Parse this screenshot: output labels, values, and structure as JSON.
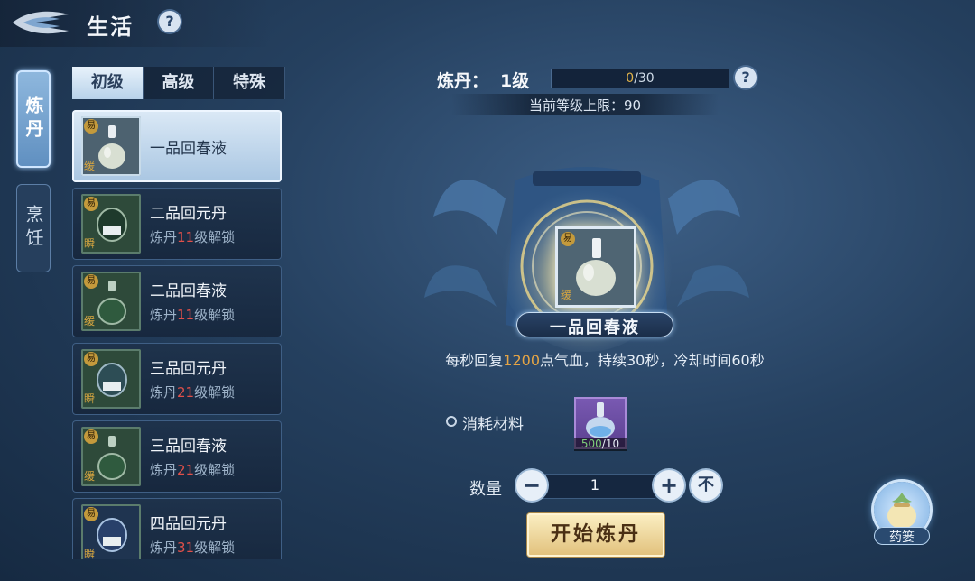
{
  "header": {
    "title": "生活",
    "help": "?"
  },
  "categories": [
    {
      "label": "炼丹",
      "active": true
    },
    {
      "label": "烹饪",
      "active": false
    }
  ],
  "grade_tabs": [
    {
      "label": "初级",
      "active": true
    },
    {
      "label": "高级",
      "active": false
    },
    {
      "label": "特殊",
      "active": false
    }
  ],
  "recipes": [
    {
      "name": "一品回春液",
      "top_badge": "易",
      "bottom_badge": "缓",
      "selected": true,
      "unlock_prefix": "",
      "unlock_level": "",
      "unlock_suffix": ""
    },
    {
      "name": "二品回元丹",
      "top_badge": "易",
      "bottom_badge": "瞬",
      "selected": false,
      "unlock_prefix": "炼丹",
      "unlock_level": "11",
      "unlock_suffix": "级解锁"
    },
    {
      "name": "二品回春液",
      "top_badge": "易",
      "bottom_badge": "缓",
      "selected": false,
      "unlock_prefix": "炼丹",
      "unlock_level": "11",
      "unlock_suffix": "级解锁"
    },
    {
      "name": "三品回元丹",
      "top_badge": "易",
      "bottom_badge": "瞬",
      "selected": false,
      "unlock_prefix": "炼丹",
      "unlock_level": "21",
      "unlock_suffix": "级解锁"
    },
    {
      "name": "三品回春液",
      "top_badge": "易",
      "bottom_badge": "缓",
      "selected": false,
      "unlock_prefix": "炼丹",
      "unlock_level": "21",
      "unlock_suffix": "级解锁"
    },
    {
      "name": "四品回元丹",
      "top_badge": "易",
      "bottom_badge": "瞬",
      "selected": false,
      "unlock_prefix": "炼丹",
      "unlock_level": "31",
      "unlock_suffix": "级解锁"
    }
  ],
  "skill": {
    "label": "炼丹：",
    "level": "1级",
    "exp_current": "0",
    "exp_total": "/30",
    "progress": 0,
    "help": "?",
    "cap_text": "当前等级上限：90"
  },
  "product": {
    "name": "一品回春液",
    "top_badge": "易",
    "bottom_badge": "缓",
    "effect_prefix": "每秒回复",
    "effect_value": "1200",
    "effect_suffix": "点气血，持续30秒，冷却时间60秒"
  },
  "materials": {
    "label": "消耗材料",
    "have": "500",
    "need": "/10"
  },
  "quantity": {
    "label": "数量",
    "value": "1",
    "minus": "−",
    "plus": "+",
    "max": "不"
  },
  "start_button": "开始炼丹",
  "book": {
    "label": "药篓"
  },
  "colors": {
    "highlight": "#e6a545",
    "locked_level": "#e0504a",
    "accent_gold": "#e1c07a"
  }
}
